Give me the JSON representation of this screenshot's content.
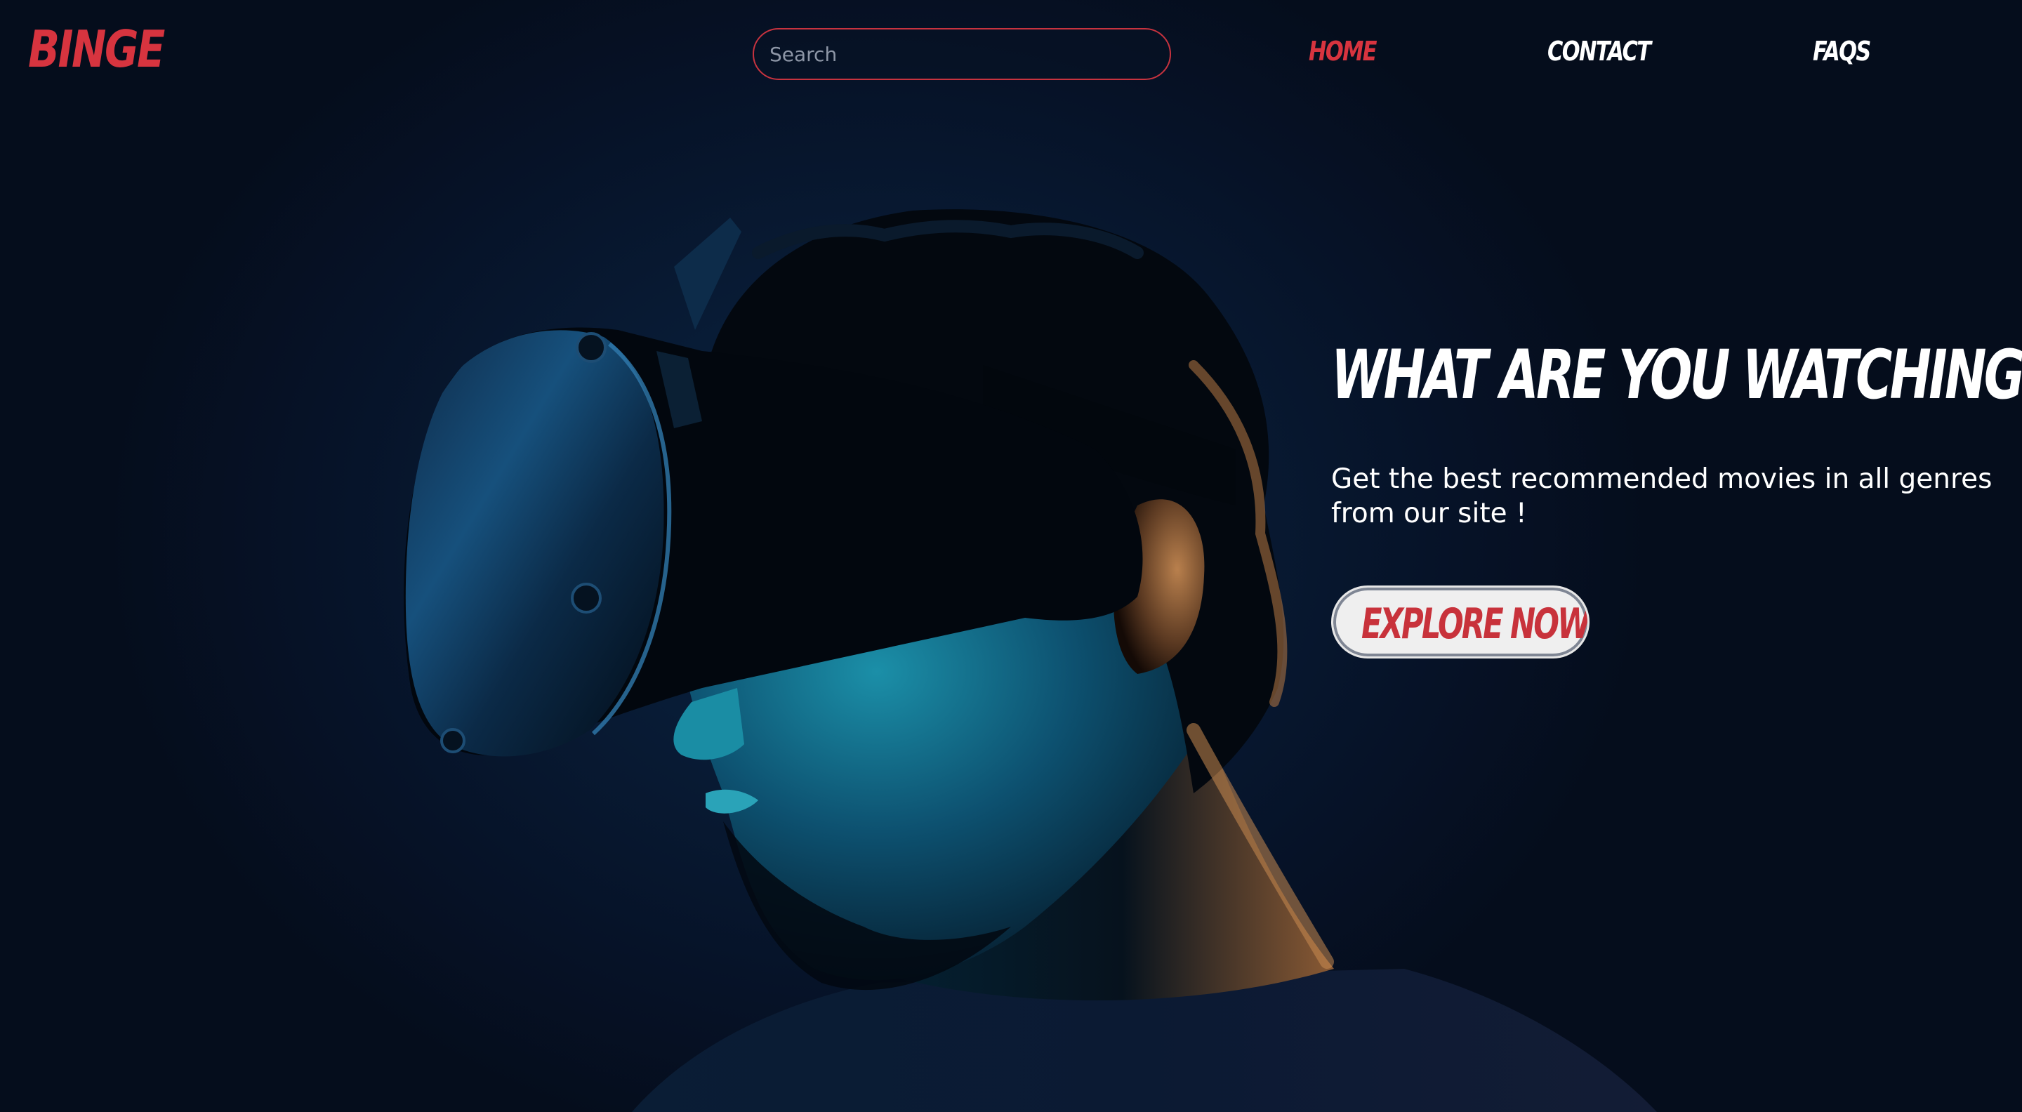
{
  "brand": {
    "logo_text": "BINGE",
    "accent_color": "#d7343f"
  },
  "search": {
    "placeholder": "Search",
    "value": ""
  },
  "nav": {
    "items": [
      {
        "label": "HOME",
        "active": true
      },
      {
        "label": "CONTACT",
        "active": false
      },
      {
        "label": "FAQS",
        "active": false
      }
    ]
  },
  "hero": {
    "headline": "WHAT ARE YOU WATCHING ?",
    "subtext": "Get the best recommended movies in all genres from our site !",
    "cta_label": "EXPLORE NOW",
    "background_image": "person-wearing-vr-headset"
  }
}
